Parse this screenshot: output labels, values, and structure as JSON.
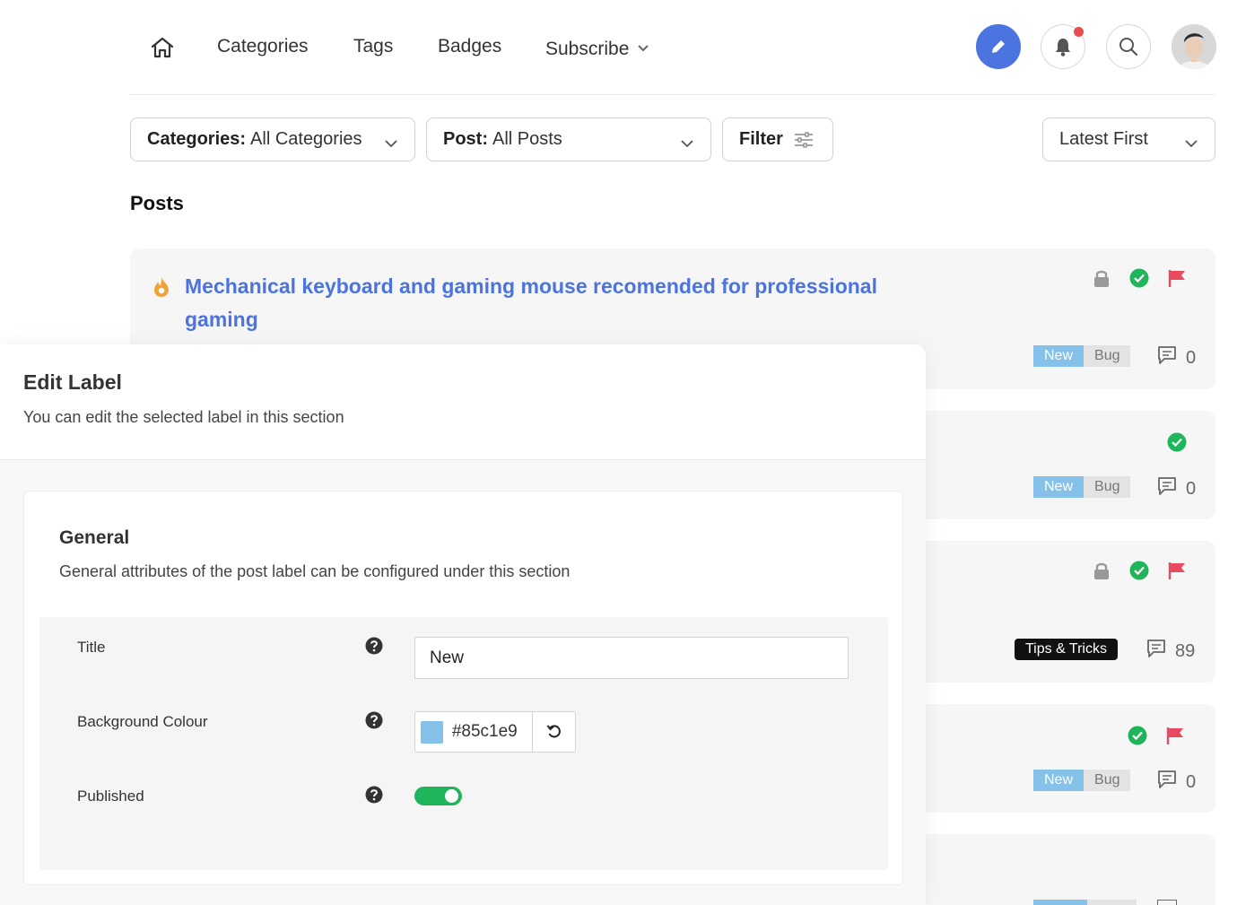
{
  "nav": {
    "links": [
      "Categories",
      "Tags",
      "Badges",
      "Subscribe"
    ]
  },
  "filters": {
    "categories_key": "Categories:",
    "categories_value": "All Categories",
    "post_key": "Post:",
    "post_value": "All Posts",
    "filter_label": "Filter",
    "sort_label": "Latest First"
  },
  "posts": {
    "heading": "Posts",
    "items": [
      {
        "title": "Mechanical keyboard and gaming mouse recomended for professional gaming",
        "tags": [
          "New",
          "Bug"
        ],
        "comments": "0"
      },
      {
        "tags": [
          "New",
          "Bug"
        ],
        "comments": "0"
      },
      {
        "tags": [
          "Tips & Tricks"
        ],
        "comments": "89"
      },
      {
        "tags": [
          "New",
          "Bug"
        ],
        "comments": "0"
      }
    ]
  },
  "edit_label": {
    "title": "Edit Label",
    "subtitle": "You can edit the selected label in this section",
    "general": {
      "title": "General",
      "subtitle": "General attributes of the post label can be configured under this section"
    },
    "fields": {
      "title_label": "Title",
      "title_value": "New",
      "bg_label": "Background Colour",
      "bg_value": "#85c1e9",
      "published_label": "Published",
      "published": true
    }
  },
  "colors": {
    "accent": "#4b74e0",
    "label_new": "#85c1e9",
    "success": "#1fb55a",
    "flag": "#e84b5f",
    "flame": "#f0a23a"
  }
}
